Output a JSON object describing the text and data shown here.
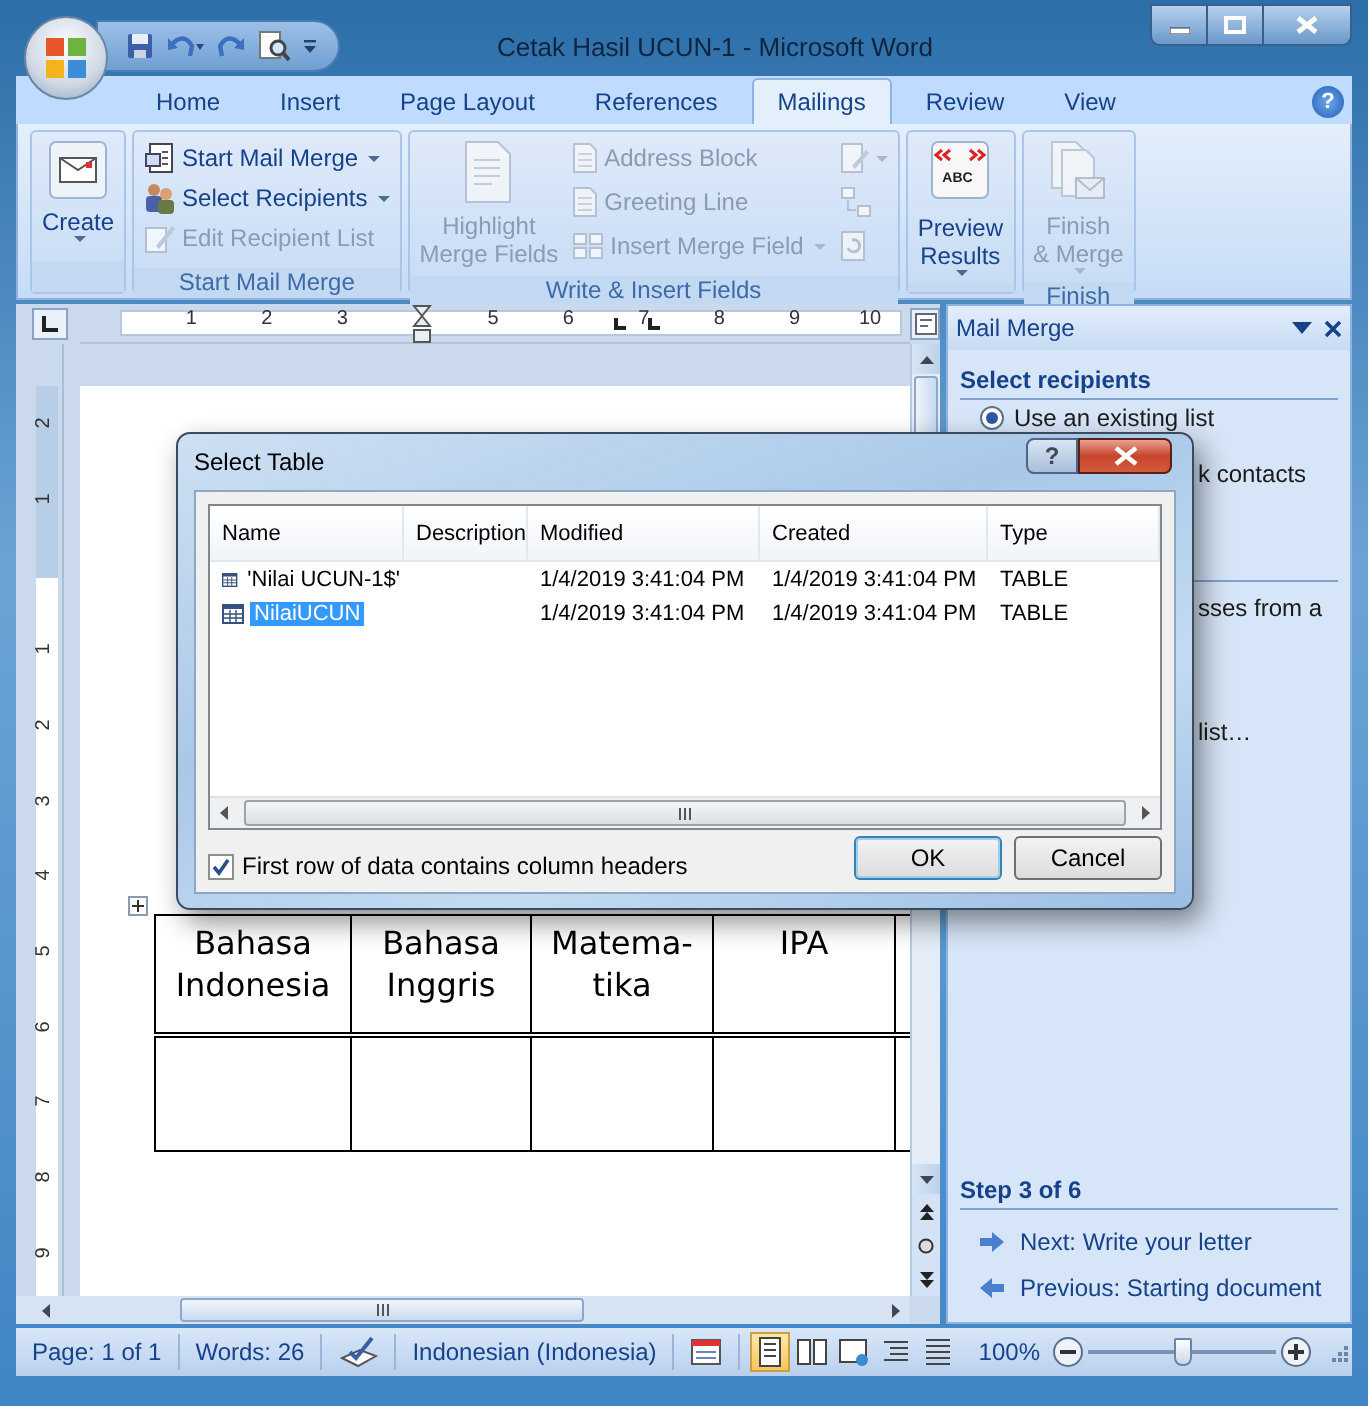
{
  "window": {
    "title": "Cetak Hasil UCUN-1 - Microsoft Word",
    "help": "?"
  },
  "tabs": [
    {
      "label": "Home",
      "selected": false
    },
    {
      "label": "Insert",
      "selected": false
    },
    {
      "label": "Page Layout",
      "selected": false
    },
    {
      "label": "References",
      "selected": false
    },
    {
      "label": "Mailings",
      "selected": true
    },
    {
      "label": "Review",
      "selected": false
    },
    {
      "label": "View",
      "selected": false
    }
  ],
  "ribbon": [
    {
      "items": [
        {
          "kind": "large",
          "label": "Create",
          "dropdown": true,
          "disabled": false
        }
      ]
    },
    {
      "label": "Start Mail Merge",
      "items": [
        {
          "kind": "small",
          "label": "Start Mail Merge",
          "dropdown": true,
          "disabled": false
        },
        {
          "kind": "small",
          "label": "Select Recipients",
          "dropdown": true,
          "disabled": false
        },
        {
          "kind": "small",
          "label": "Edit Recipient List",
          "dropdown": false,
          "disabled": true
        }
      ]
    },
    {
      "label": "Write & Insert Fields",
      "items": [
        {
          "kind": "large",
          "label": "Highlight Merge Fields",
          "dropdown": false,
          "disabled": true
        },
        {
          "kind": "small",
          "label": "Address Block",
          "dropdown": false,
          "disabled": true
        },
        {
          "kind": "small",
          "label": "Greeting Line",
          "dropdown": false,
          "disabled": true
        },
        {
          "kind": "small",
          "label": "Insert Merge Field",
          "dropdown": true,
          "disabled": true
        },
        {
          "kind": "icon",
          "dropdown": true,
          "disabled": true
        },
        {
          "kind": "icon",
          "dropdown": false,
          "disabled": true
        },
        {
          "kind": "icon",
          "dropdown": false,
          "disabled": true
        }
      ]
    },
    {
      "items": [
        {
          "kind": "large",
          "label": "Preview Results",
          "badge": "ABC",
          "dropdown": true,
          "disabled": false
        }
      ]
    },
    {
      "label": "Finish",
      "items": [
        {
          "kind": "large",
          "label": "Finish & Merge",
          "dropdown": true,
          "disabled": true
        }
      ]
    }
  ],
  "ruler": {
    "labels": [
      "1",
      "2",
      "3",
      "5",
      "6",
      "7",
      "8",
      "9",
      "10"
    ]
  },
  "vertical_ruler": {
    "labels": [
      "2",
      "1",
      "1",
      "2",
      "3",
      "4",
      "5",
      "6",
      "7",
      "8",
      "9"
    ]
  },
  "document": {
    "table": {
      "columns": [
        "Bahasa Indonesia",
        "Bahasa Inggris",
        "Matema-tika",
        "IPA"
      ]
    }
  },
  "task_pane": {
    "title": "Mail Merge",
    "section": "Select recipients",
    "options": [
      {
        "label": "Use an existing list",
        "selected": true
      }
    ],
    "partial_texts": [
      "k contacts",
      "sses from a",
      "list…"
    ],
    "step": "Step 3 of 6",
    "links": [
      {
        "kind": "next",
        "label": "Next: Write your letter"
      },
      {
        "kind": "previous",
        "label": "Previous: Starting document"
      }
    ]
  },
  "dialog": {
    "title": "Select Table",
    "help": "?",
    "columns": [
      "Name",
      "Description",
      "Modified",
      "Created",
      "Type"
    ],
    "rows": [
      {
        "cells": [
          "'Nilai UCUN-1$'",
          "",
          "1/4/2019 3:41:04 PM",
          "1/4/2019 3:41:04 PM",
          "TABLE"
        ],
        "selected": false
      },
      {
        "cells": [
          "NilaiUCUN",
          "",
          "1/4/2019 3:41:04 PM",
          "1/4/2019 3:41:04 PM",
          "TABLE"
        ],
        "selected": true
      }
    ],
    "checkbox": {
      "label": "First row of data contains column headers",
      "checked": true
    },
    "buttons": [
      {
        "label": "OK",
        "default": true
      },
      {
        "label": "Cancel",
        "default": false
      }
    ]
  },
  "status_bar": {
    "page": "Page: 1 of 1",
    "words": "Words: 26",
    "language": "Indonesian (Indonesia)",
    "views": [
      {
        "selected": true
      },
      {
        "selected": false
      },
      {
        "selected": false
      },
      {
        "selected": false
      },
      {
        "selected": false
      }
    ],
    "zoom": "100%",
    "zoom_slider": {
      "level": 0.5
    }
  }
}
